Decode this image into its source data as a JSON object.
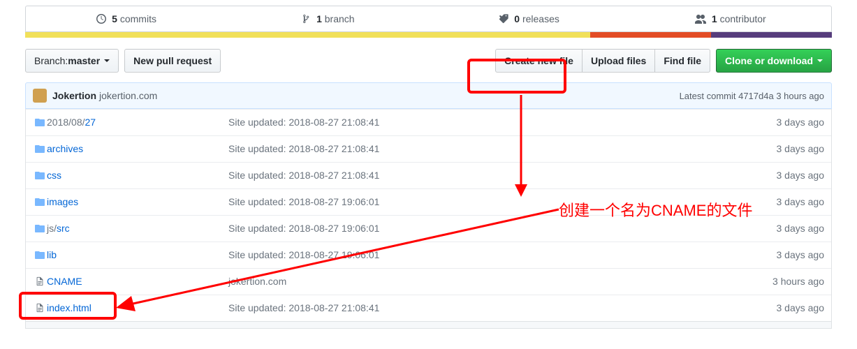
{
  "stats": {
    "commits": {
      "count": "5",
      "label": "commits"
    },
    "branches": {
      "count": "1",
      "label": "branch"
    },
    "releases": {
      "count": "0",
      "label": "releases"
    },
    "contributors": {
      "count": "1",
      "label": "contributor"
    }
  },
  "toolbar": {
    "branch_label_prefix": "Branch: ",
    "branch_name": "master",
    "new_pr": "New pull request",
    "create_file": "Create new file",
    "upload_files": "Upload files",
    "find_file": "Find file",
    "clone": "Clone or download"
  },
  "commit": {
    "author": "Jokertion",
    "message": "jokertion.com",
    "latest_prefix": "Latest commit ",
    "sha": "4717d4a",
    "age": " 3 hours ago"
  },
  "files": [
    {
      "type": "dir",
      "name": "2018/08/27",
      "dim_prefix": "2018/08/",
      "bright": "27",
      "msg": "Site updated: 2018-08-27 21:08:41",
      "age": "3 days ago"
    },
    {
      "type": "dir",
      "name": "archives",
      "msg": "Site updated: 2018-08-27 21:08:41",
      "age": "3 days ago"
    },
    {
      "type": "dir",
      "name": "css",
      "msg": "Site updated: 2018-08-27 21:08:41",
      "age": "3 days ago"
    },
    {
      "type": "dir",
      "name": "images",
      "msg": "Site updated: 2018-08-27 19:06:01",
      "age": "3 days ago"
    },
    {
      "type": "dir",
      "name": "js/src",
      "dim_prefix": "js/",
      "bright": "src",
      "msg": "Site updated: 2018-08-27 19:06:01",
      "age": "3 days ago"
    },
    {
      "type": "dir",
      "name": "lib",
      "msg": "Site updated: 2018-08-27 19:06:01",
      "age": "3 days ago"
    },
    {
      "type": "file",
      "name": "CNAME",
      "msg": "jokertion.com",
      "age": "3 hours ago"
    },
    {
      "type": "file",
      "name": "index.html",
      "msg": "Site updated: 2018-08-27 21:08:41",
      "age": "3 days ago"
    }
  ],
  "annotation": {
    "text": "创建一个名为CNAME的文件"
  }
}
